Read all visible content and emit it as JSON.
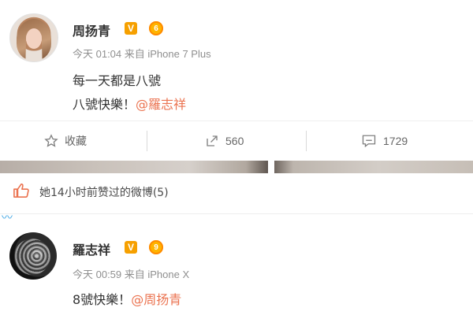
{
  "post1": {
    "username": "周扬青",
    "verified_badge": "V",
    "level_badge": "6",
    "meta": "今天 01:04 来自 iPhone 7 Plus",
    "line1": "每一天都是八號",
    "line2_prefix": "八號快樂！",
    "line2_mention": "@羅志祥"
  },
  "actions": {
    "favorite_label": "收藏",
    "repost_count": "560",
    "comment_count": "1729"
  },
  "like_notice": "她14小时前赞过的微博(5)",
  "post2": {
    "username": "羅志祥",
    "verified_badge": "V",
    "level_badge": "9",
    "meta": "今天 00:59 来自 iPhone X",
    "text_prefix": "8號快樂！",
    "text_mention": "@周扬青"
  },
  "colors": {
    "mention": "#eb7350",
    "verified": "#f6a000",
    "meta": "#8f8f8f"
  }
}
